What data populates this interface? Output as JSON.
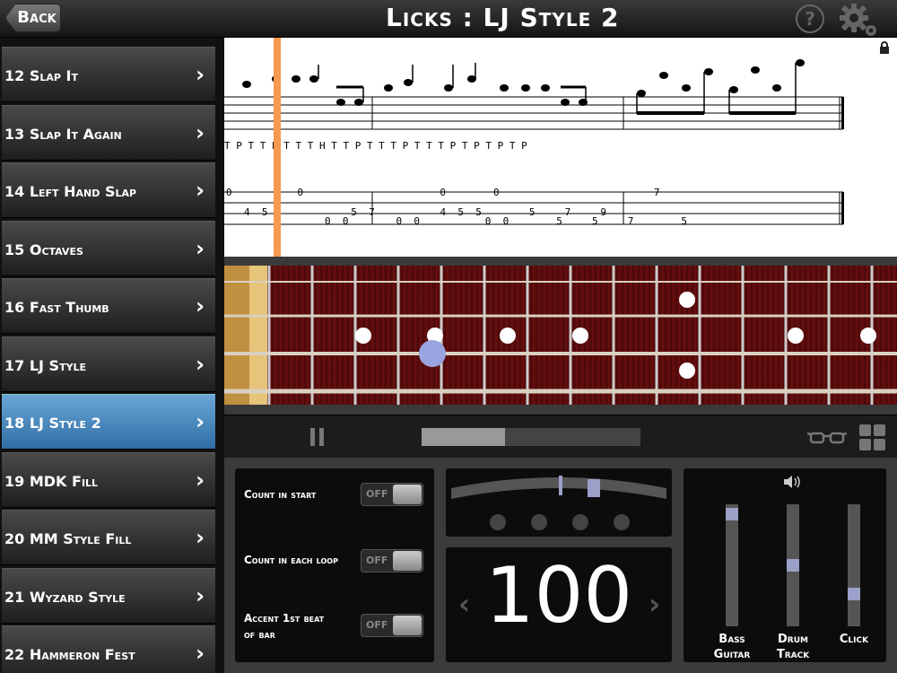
{
  "header": {
    "back_label": "Back",
    "title": "Licks : LJ Style 2"
  },
  "sidebar": {
    "items": [
      {
        "label": "12 Slap It",
        "selected": false
      },
      {
        "label": "13 Slap It Again",
        "selected": false
      },
      {
        "label": "14 Left Hand Slap",
        "selected": false
      },
      {
        "label": "15 Octaves",
        "selected": false
      },
      {
        "label": "16 Fast Thumb",
        "selected": false
      },
      {
        "label": "17 LJ Style",
        "selected": false
      },
      {
        "label": "18 LJ Style 2",
        "selected": true
      },
      {
        "label": "19 MDK Fill",
        "selected": false
      },
      {
        "label": "20 MM Style Fill",
        "selected": false
      },
      {
        "label": "21 Wyzard Style",
        "selected": false
      },
      {
        "label": "22 Hammeron Fest",
        "selected": false
      }
    ]
  },
  "score": {
    "technique_row": "T  P  T  T  P  T  T     T  H  T  T  P  T  T  T  P  T  T        T  P  T  P  T  P  T  P",
    "tab_top": "0           0                       0        0                          7",
    "tab_mid": "4  5              5  7           4  5  5        5     7     9",
    "tab_bot": "0  0        0  0           0  0        5     5     7        5",
    "playhead_color": "#f59a4e"
  },
  "transport": {
    "progress": 0.38
  },
  "options": {
    "count_in_start": {
      "label": "Count in start",
      "state": "OFF"
    },
    "count_in_loop": {
      "label": "Count in each loop",
      "state": "OFF"
    },
    "accent_beat": {
      "label_line1": "Accent 1st beat",
      "label_line2": "of bar",
      "state": "OFF"
    }
  },
  "tempo": {
    "value": "100",
    "left_arrow": "‹",
    "right_arrow": "›"
  },
  "mixer": {
    "bass": {
      "line1": "Bass",
      "line2": "Guitar",
      "level": 0.97
    },
    "drum": {
      "line1": "Drum",
      "line2": "Track",
      "level": 0.5
    },
    "click": {
      "line1": "Click",
      "line2": "",
      "level": 0.24
    }
  }
}
